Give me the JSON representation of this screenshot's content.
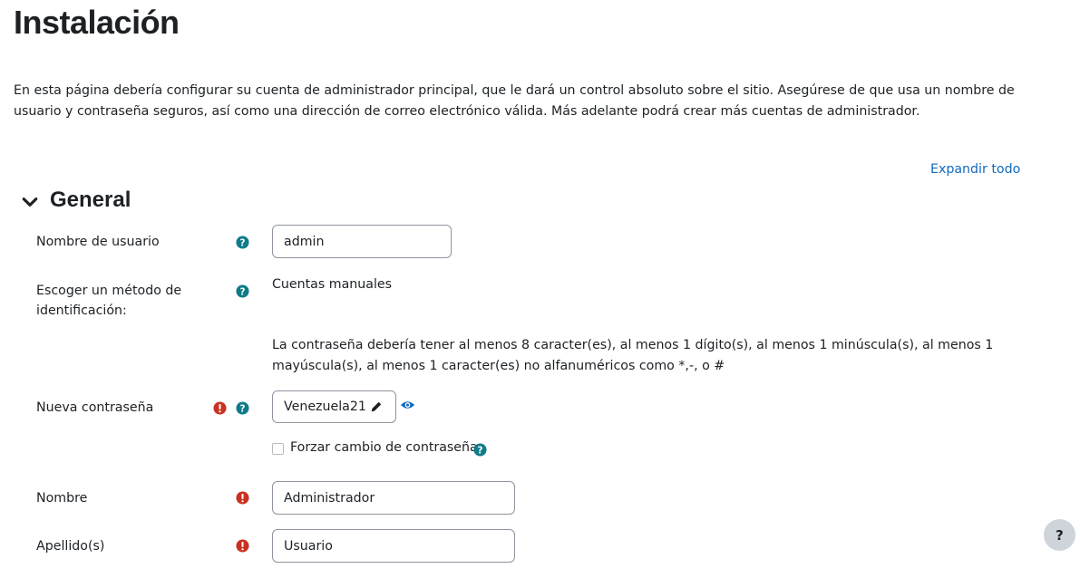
{
  "page": {
    "title": "Instalación",
    "intro": "En esta página debería configurar su cuenta de administrador principal, que le dará un control absoluto sobre el sitio. Asegúrese de que usa un nombre de usuario y contraseña seguros, así como una dirección de correo electrónico válida. Más adelante podrá crear más cuentas de administrador.",
    "expand_all": "Expandir todo"
  },
  "section": {
    "title": "General"
  },
  "fields": {
    "username": {
      "label": "Nombre de usuario",
      "value": "admin"
    },
    "auth_method": {
      "label": "Escoger un método de identificación:",
      "value": "Cuentas manuales"
    },
    "password_hint": "La contraseña debería tener al menos 8 caracter(es), al menos 1 dígito(s), al menos 1 minúscula(s), al menos 1 mayúscula(s), al menos 1 caracter(es) no alfanuméricos como *,-, o #",
    "new_password": {
      "label": "Nueva contraseña",
      "value": "Venezuela21"
    },
    "force_change": {
      "label": "Forzar cambio de contraseña",
      "checked": false
    },
    "firstname": {
      "label": "Nombre",
      "value": "Administrador"
    },
    "lastname": {
      "label": "Apellido(s)",
      "value": "Usuario"
    }
  },
  "help_button": {
    "label": "?"
  },
  "colors": {
    "help_icon": "#0f7b8a",
    "required_icon": "#ca3120",
    "link": "#0f6cbf"
  }
}
